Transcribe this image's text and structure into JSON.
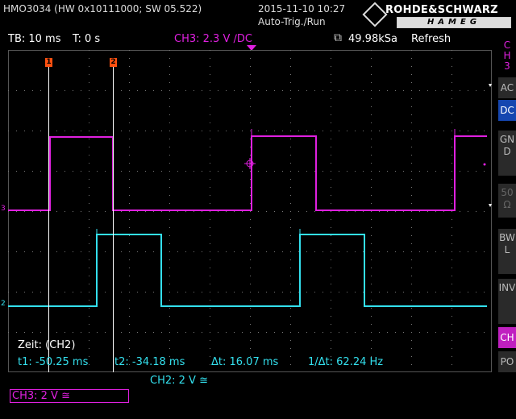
{
  "header": {
    "device_info": "HMO3034 (HW 0x10111000; SW 05.522)",
    "datetime": "2015-11-10 10:27",
    "trigger_mode": "Auto-Trig./Run",
    "brand_top": "ROHDE&SCHWARZ",
    "brand_bottom": "HAMEG"
  },
  "status_line": {
    "timebase": "TB: 10 ms",
    "trigger_time": "T: 0 s",
    "trigger_channel": "CH3: 2.3 V ∕DC",
    "sample_rate": "49.98kSa",
    "acquisition": "Refresh"
  },
  "sidebar": {
    "channel_label": "C\nH\n3",
    "items": [
      {
        "label": "AC",
        "state": "normal"
      },
      {
        "label": "DC",
        "state": "active"
      },
      {
        "label": "GND",
        "state": "normal"
      },
      {
        "label": "50 Ω",
        "state": "dim"
      },
      {
        "label": "BWL",
        "state": "normal"
      },
      {
        "label": "INV",
        "state": "normal"
      },
      {
        "label": "CH",
        "state": "channel"
      },
      {
        "label": "PO",
        "state": "normal"
      }
    ]
  },
  "markers": {
    "cursor1": "1",
    "cursor2": "2",
    "ch3_ground": "3",
    "ch2_ground": "2"
  },
  "cursor_readout": {
    "zeit": "Zeit: (CH2)",
    "t1": "t1: -50.25 ms",
    "t2": "t2: -34.18 ms",
    "dt": "Δt: 16.07 ms",
    "inv_dt": "1/Δt: 62.24 Hz"
  },
  "channels": {
    "ch2": "CH2: 2 V ≅",
    "ch3": "CH3: 2 V ≅"
  },
  "colors": {
    "ch2": "#33e0ee",
    "ch3": "#e020e0",
    "cursor_marker": "#ff5010",
    "active_button": "#1546b0"
  }
}
